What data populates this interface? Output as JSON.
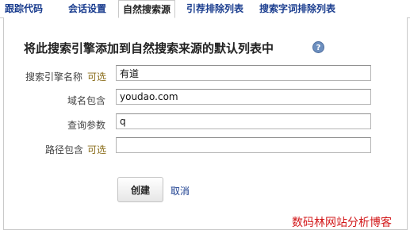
{
  "tabs": [
    {
      "label": "跟踪代码",
      "active": false
    },
    {
      "label": "会话设置",
      "active": false
    },
    {
      "label": "自然搜索源",
      "active": true
    },
    {
      "label": "引荐排除列表",
      "active": false
    },
    {
      "label": "搜索字词排除列表",
      "active": false
    }
  ],
  "form": {
    "heading": "将此搜索引擎添加到自然搜索来源的默认列表中",
    "help_icon": "?",
    "fields": [
      {
        "label": "搜索引擎名称",
        "optional": "可选",
        "value": "有道"
      },
      {
        "label": "域名包含",
        "optional": "",
        "value": "youdao.com"
      },
      {
        "label": "查询参数",
        "optional": "",
        "value": "q"
      },
      {
        "label": "路径包含",
        "optional": "可选",
        "value": ""
      }
    ],
    "create_label": "创建",
    "cancel_label": "取消"
  },
  "watermark": "数码林网站分析博客"
}
